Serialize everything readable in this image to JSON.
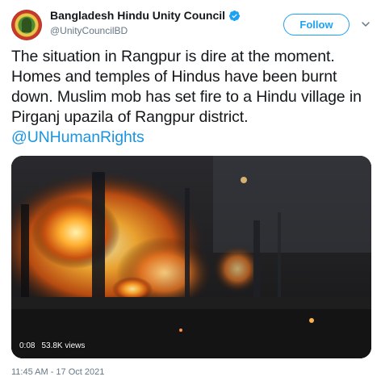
{
  "tweet": {
    "display_name": "Bangladesh Hindu Unity Council",
    "handle": "@UnityCouncilBD",
    "follow_label": "Follow",
    "text": "The situation in Rangpur is dire at the moment. Homes and temples of Hindus have been burnt down. Muslim mob has set fire to a Hindu village in Pirganj upazila of Rangpur district. ",
    "mention": "@UNHumanRights",
    "timestamp": "11:45 AM - 17 Oct 2021"
  },
  "video": {
    "duration": "0:08",
    "views": "53.8K views"
  },
  "colors": {
    "accent": "#1da1f2",
    "mention": "#1b95e0",
    "secondary_text": "#657786"
  },
  "icons": {
    "verified": "verified-badge-icon",
    "chevron": "chevron-down-icon"
  }
}
